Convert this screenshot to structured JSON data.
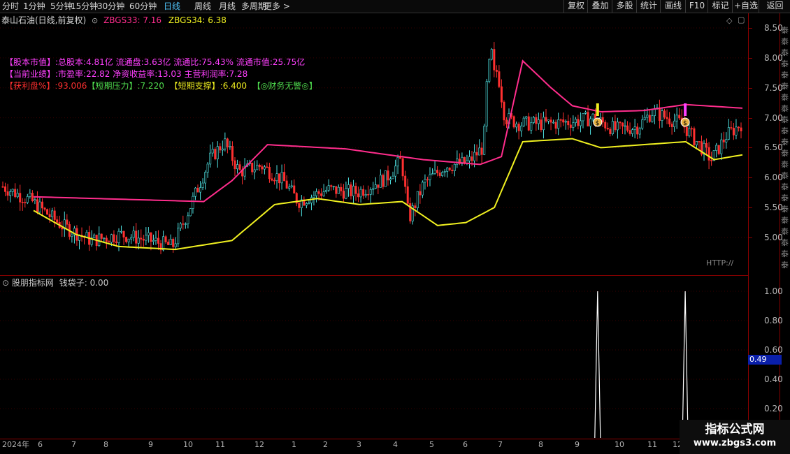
{
  "toolbar": {
    "timeframes": [
      "分时",
      "1分钟",
      "5分钟",
      "15分钟",
      "30分钟",
      "60分钟",
      "日线",
      "周线",
      "月线",
      "多周期",
      "更多 >"
    ],
    "active": "日线",
    "right_buttons": [
      "复权",
      "叠加",
      "多股",
      "统计",
      "画线",
      "F10",
      "标记",
      "+自选",
      "返回"
    ]
  },
  "header": {
    "stock": "泰山石油(日线,前复权)",
    "zbgs33": "ZBGS33: 7.16",
    "zbgs34": "ZBGS34: 6.38",
    "http": "HTTP://"
  },
  "info": {
    "line1_tag": "【股本市值】:",
    "line1_val": "总股本:4.81亿 流通盘:3.63亿 流通比:75.43% 流通市值:25.75亿",
    "line2_tag": "【当前业绩】:",
    "line2_val": "市盈率:22.82 净资收益率:13.03 主营利润率:7.28",
    "l3_a": "【获利盘%】:93.006",
    "l3_b": "【短期压力】:7.220",
    "l3_c": "【短期支撑】:6.400",
    "l3_d": "【◎财务无警◎】"
  },
  "panel2": {
    "title": "股朋指标网",
    "indicator": "钱袋子: 0.00",
    "highlight": "0.49"
  },
  "axes": {
    "price_ticks": [
      "8.50",
      "8.00",
      "7.50",
      "7.00",
      "6.50",
      "6.00",
      "5.50",
      "5.00"
    ],
    "ind_ticks": [
      "1.00",
      "0.80",
      "0.60",
      "0.40",
      "0.20"
    ],
    "x_labels": [
      "2024年",
      "6",
      "7",
      "8",
      "9",
      "10",
      "11",
      "12",
      "1",
      "2",
      "3",
      "4",
      "5",
      "6",
      "7",
      "8",
      "9",
      "10",
      "11",
      "12"
    ]
  },
  "side_chars": "泰泰泰泰泰泰泰泰泰泰泰泰泰泰泰泰泰泰泰泰泰泰",
  "side_chars2": "自泰1111111",
  "watermark": {
    "line1": "指标公式网",
    "line2": "www.zbgs3.com"
  },
  "colors": {
    "up": "#4fe0e0",
    "down": "#ff3030",
    "ma_pink": "#ff2d8c",
    "ma_yellow": "#f0f020",
    "bg": "#000000"
  },
  "chart_data": {
    "type": "candlestick",
    "ylim": [
      4.55,
      8.6
    ],
    "pink_line": [
      [
        0.0,
        5.68
      ],
      [
        0.24,
        5.6
      ],
      [
        0.28,
        5.95
      ],
      [
        0.33,
        6.55
      ],
      [
        0.44,
        6.48
      ],
      [
        0.55,
        6.3
      ],
      [
        0.63,
        6.22
      ],
      [
        0.66,
        6.35
      ],
      [
        0.69,
        7.95
      ],
      [
        0.73,
        7.5
      ],
      [
        0.76,
        7.2
      ],
      [
        0.8,
        7.1
      ],
      [
        0.86,
        7.12
      ],
      [
        0.92,
        7.22
      ],
      [
        1.0,
        7.16
      ]
    ],
    "yellow_line": [
      [
        0.0,
        5.45
      ],
      [
        0.06,
        5.05
      ],
      [
        0.12,
        4.85
      ],
      [
        0.2,
        4.8
      ],
      [
        0.28,
        4.95
      ],
      [
        0.34,
        5.55
      ],
      [
        0.4,
        5.65
      ],
      [
        0.46,
        5.55
      ],
      [
        0.52,
        5.6
      ],
      [
        0.57,
        5.2
      ],
      [
        0.61,
        5.25
      ],
      [
        0.65,
        5.5
      ],
      [
        0.69,
        6.6
      ],
      [
        0.76,
        6.65
      ],
      [
        0.8,
        6.5
      ],
      [
        0.86,
        6.55
      ],
      [
        0.92,
        6.6
      ],
      [
        0.96,
        6.3
      ],
      [
        1.0,
        6.38
      ]
    ],
    "signals": [
      0.803,
      0.921
    ],
    "signal_values": [
      1.0,
      1.0
    ]
  }
}
